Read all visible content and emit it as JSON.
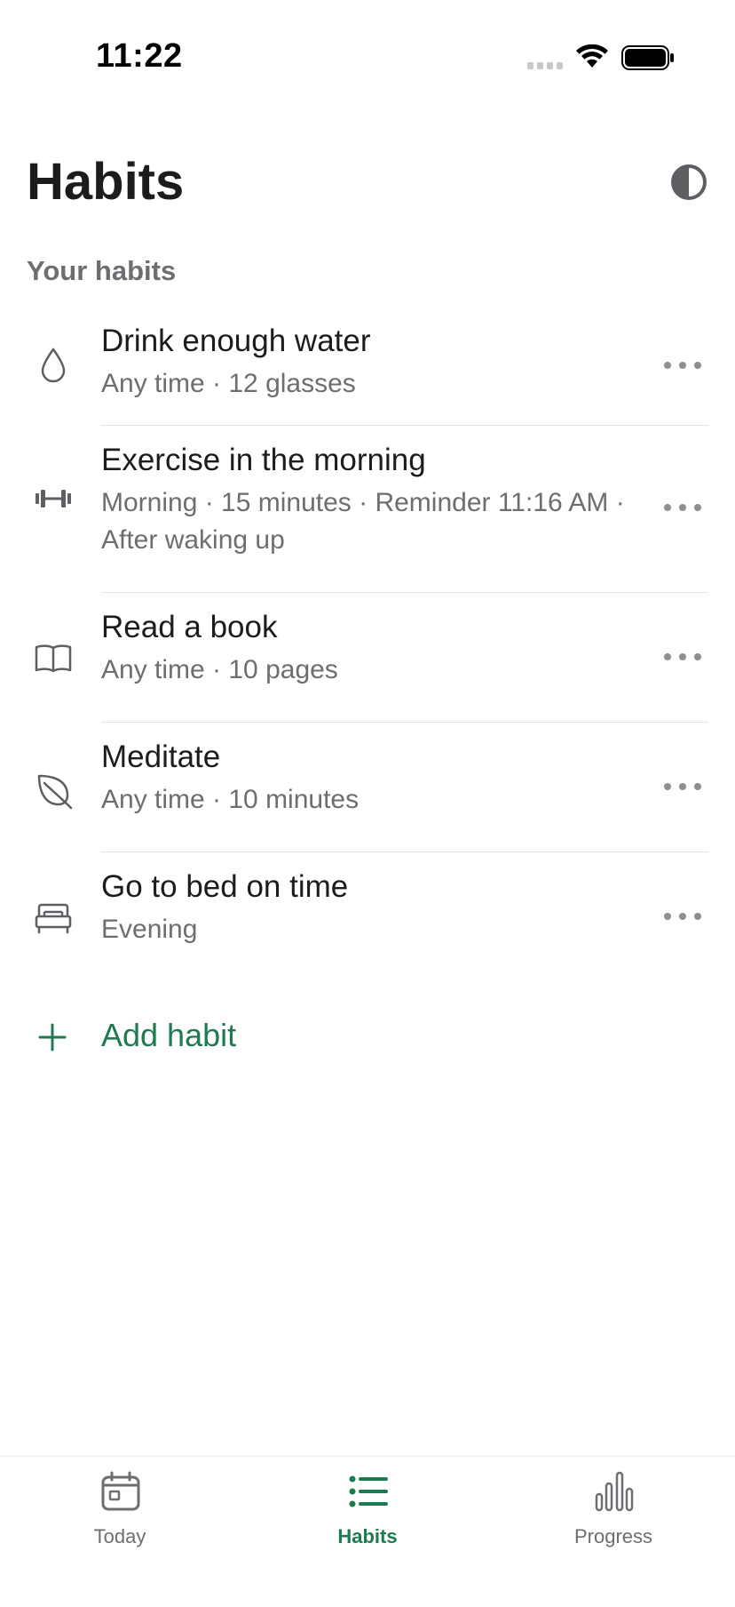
{
  "status_bar": {
    "time": "11:22"
  },
  "header": {
    "title": "Habits",
    "theme_toggle_icon": "half-circle-contrast-icon"
  },
  "section": {
    "title": "Your habits"
  },
  "habits": [
    {
      "icon": "water-drop-icon",
      "title": "Drink enough water",
      "subtitle": "Any time · 12 glasses"
    },
    {
      "icon": "dumbbell-icon",
      "title": "Exercise in the morning",
      "subtitle": "Morning · 15 minutes · Reminder 11:16 AM · After waking up"
    },
    {
      "icon": "open-book-icon",
      "title": "Read a book",
      "subtitle": "Any time · 10 pages"
    },
    {
      "icon": "leaf-icon",
      "title": "Meditate",
      "subtitle": "Any time · 10 minutes"
    },
    {
      "icon": "bed-icon",
      "title": "Go to bed on time",
      "subtitle": "Evening"
    }
  ],
  "add_habit": {
    "label": "Add habit",
    "icon": "plus-icon"
  },
  "tabs": [
    {
      "label": "Today",
      "icon": "calendar-icon",
      "active": false
    },
    {
      "label": "Habits",
      "icon": "list-icon",
      "active": true
    },
    {
      "label": "Progress",
      "icon": "bar-chart-icon",
      "active": false
    }
  ],
  "colors": {
    "accent": "#1e7a4f",
    "text_primary": "#1c1c1e",
    "text_secondary": "#6d6d72",
    "icon_gray": "#5f5f63",
    "divider": "#e3e3e6"
  }
}
